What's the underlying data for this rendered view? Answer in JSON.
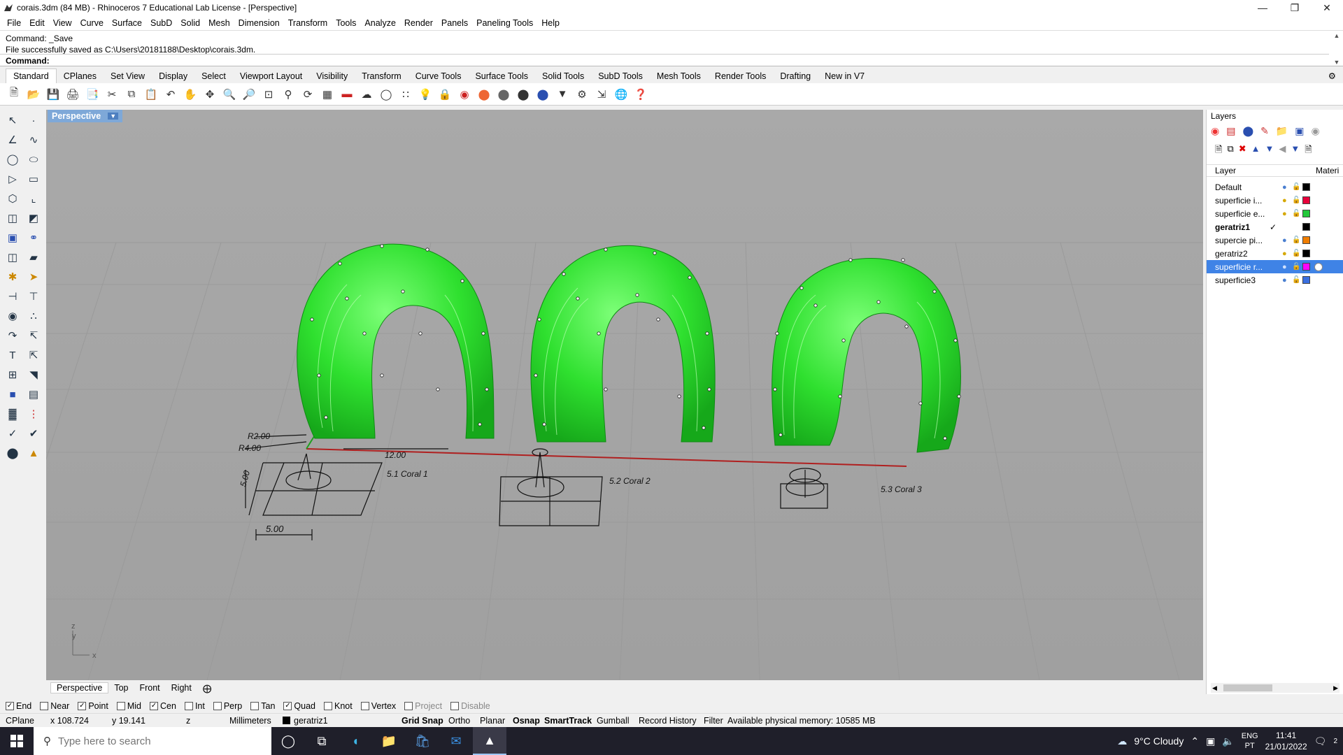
{
  "window": {
    "title": "corais.3dm (84 MB) - Rhinoceros 7 Educational Lab License - [Perspective]"
  },
  "menu": [
    "File",
    "Edit",
    "View",
    "Curve",
    "Surface",
    "SubD",
    "Solid",
    "Mesh",
    "Dimension",
    "Transform",
    "Tools",
    "Analyze",
    "Render",
    "Panels",
    "Paneling Tools",
    "Help"
  ],
  "command": {
    "history_1": "Command: _Save",
    "history_2": "File successfully saved as C:\\Users\\20181188\\Desktop\\corais.3dm.",
    "prompt_label": "Command:",
    "input_value": ""
  },
  "toolbar_tabs": [
    "Standard",
    "CPlanes",
    "Set View",
    "Display",
    "Select",
    "Viewport Layout",
    "Visibility",
    "Transform",
    "Curve Tools",
    "Surface Tools",
    "Solid Tools",
    "SubD Tools",
    "Mesh Tools",
    "Render Tools",
    "Drafting",
    "New in V7"
  ],
  "toolbar_icons": [
    "new-icon",
    "open-icon",
    "save-icon",
    "print-icon",
    "import-icon",
    "cut-icon",
    "copy-icon",
    "paste-icon",
    "undo-icon",
    "pan-hand-icon",
    "rotate-icon",
    "zoom-icon",
    "zoom-window-icon",
    "zoom-extents-icon",
    "zoom-selected-icon",
    "rotate-view-icon",
    "grid-icon",
    "car-icon",
    "render-icon",
    "circle-icon",
    "points-icon",
    "light-icon",
    "lock-icon",
    "material-icon",
    "color-wheel-icon",
    "shaded-sphere-icon",
    "rendered-sphere-icon",
    "blue-sphere-icon",
    "filter-icon",
    "settings-icon",
    "dimension-icon",
    "globe-icon",
    "help-icon"
  ],
  "viewport": {
    "label": "Perspective",
    "annotations": {
      "r2": "R2.00",
      "r4": "R4.00",
      "d12": "12.00",
      "d500v": "5.00",
      "d500h": "5.00",
      "coral1": "5.1 Coral 1",
      "coral2": "5.2 Coral 2",
      "coral3": "5.3 Coral 3"
    },
    "axes": {
      "z": "z",
      "y": "y",
      "x": "x"
    }
  },
  "view_tabs": [
    "Perspective",
    "Top",
    "Front",
    "Right"
  ],
  "layers_panel": {
    "title": "Layers",
    "header_layer": "Layer",
    "header_material": "Materi",
    "layers": [
      {
        "name": "Default",
        "color": "#000000",
        "bulb": "#4a7fd0"
      },
      {
        "name": "superficie i...",
        "color": "#e8003a",
        "bulb": "#e0b000"
      },
      {
        "name": "superficie e...",
        "color": "#22c83a",
        "bulb": "#e0b000"
      },
      {
        "name": "geratriz1",
        "color": "#000000",
        "current": "✓"
      },
      {
        "name": "supercie pi...",
        "color": "#f07d00",
        "bulb": "#4a7fd0"
      },
      {
        "name": "geratriz2",
        "color": "#000000",
        "bulb": "#e0b000"
      },
      {
        "name": "superficie r...",
        "color": "#ff00ff",
        "bulb": "#4a7fd0"
      },
      {
        "name": "superficie3",
        "color": "#3a6fe0",
        "bulb": "#4a7fd0"
      }
    ]
  },
  "osnap": [
    {
      "label": "End",
      "checked": true
    },
    {
      "label": "Near",
      "checked": false
    },
    {
      "label": "Point",
      "checked": true
    },
    {
      "label": "Mid",
      "checked": false
    },
    {
      "label": "Cen",
      "checked": true
    },
    {
      "label": "Int",
      "checked": false
    },
    {
      "label": "Perp",
      "checked": false
    },
    {
      "label": "Tan",
      "checked": false
    },
    {
      "label": "Quad",
      "checked": true
    },
    {
      "label": "Knot",
      "checked": false
    },
    {
      "label": "Vertex",
      "checked": false
    },
    {
      "label": "Project",
      "checked": false
    },
    {
      "label": "Disable",
      "checked": false
    }
  ],
  "status": {
    "cplane": "CPlane",
    "x": "x 108.724",
    "y": "y 19.141",
    "z": "z",
    "units": "Millimeters",
    "layer": "geratriz1",
    "grid_snap": "Grid Snap",
    "ortho": "Ortho",
    "planar": "Planar",
    "osnap": "Osnap",
    "smarttrack": "SmartTrack",
    "gumball": "Gumball",
    "record_history": "Record History",
    "filter": "Filter",
    "memory": "Available physical memory: 10585 MB"
  },
  "taskbar": {
    "search_placeholder": "Type here to search",
    "weather": "9°C  Cloudy",
    "lang1": "ENG",
    "lang2": "PT",
    "time": "11:41",
    "date": "21/01/2022",
    "notifications": "2"
  }
}
